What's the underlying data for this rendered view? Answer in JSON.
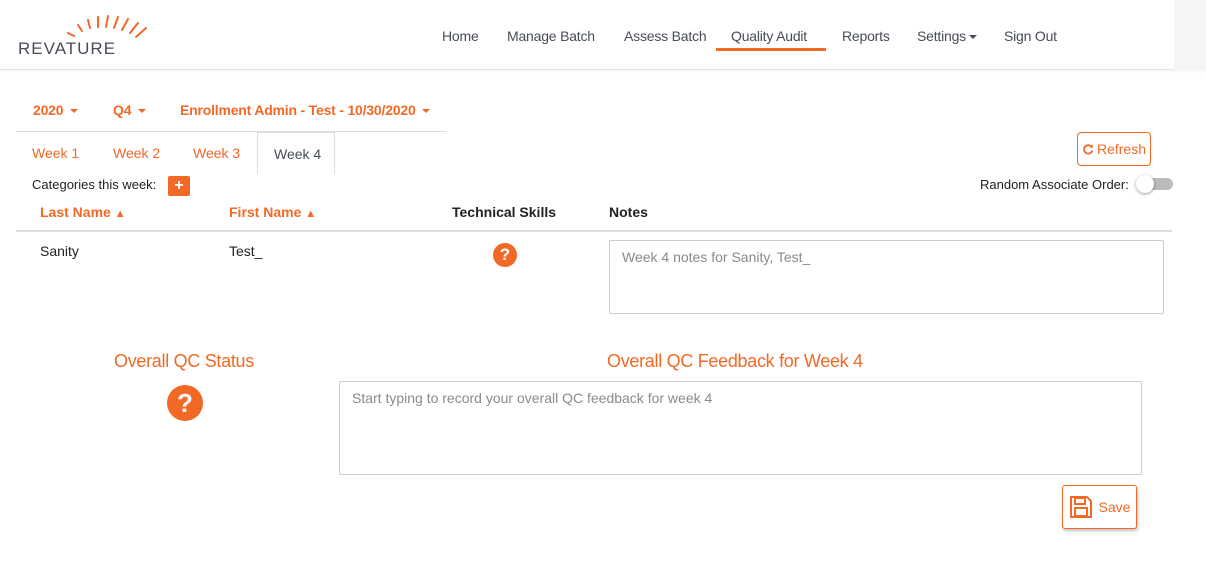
{
  "brand": {
    "logo_text": "REVATURE",
    "accent": "#f26925"
  },
  "nav": {
    "home": "Home",
    "manage_batch": "Manage Batch",
    "assess_batch": "Assess Batch",
    "quality_audit": "Quality Audit",
    "reports": "Reports",
    "settings": "Settings",
    "sign_out": "Sign Out",
    "active": "Quality Audit"
  },
  "filters": {
    "year": "2020",
    "quarter": "Q4",
    "batch": "Enrollment Admin - Test - 10/30/2020"
  },
  "tabs": [
    {
      "label": "Week 1"
    },
    {
      "label": "Week 2"
    },
    {
      "label": "Week 3"
    },
    {
      "label": "Week 4",
      "active": true
    }
  ],
  "refresh_label": "Refresh",
  "categories_label": "Categories this week:",
  "add_category_label": "+",
  "random_order_label": "Random Associate Order:",
  "random_order_on": false,
  "table": {
    "headers": {
      "last_name": "Last Name",
      "first_name": "First Name",
      "technical_skills": "Technical Skills",
      "notes": "Notes"
    },
    "rows": [
      {
        "last_name": "Sanity",
        "first_name": "Test_",
        "technical_skills_icon": "question-circle-icon",
        "notes_placeholder": "Week 4 notes for Sanity, Test_"
      }
    ]
  },
  "overall": {
    "status_title": "Overall QC Status",
    "status_icon": "question-circle-icon",
    "feedback_title": "Overall QC Feedback for Week 4",
    "feedback_placeholder": "Start typing to record your overall QC feedback for week 4"
  },
  "save_label": "Save"
}
